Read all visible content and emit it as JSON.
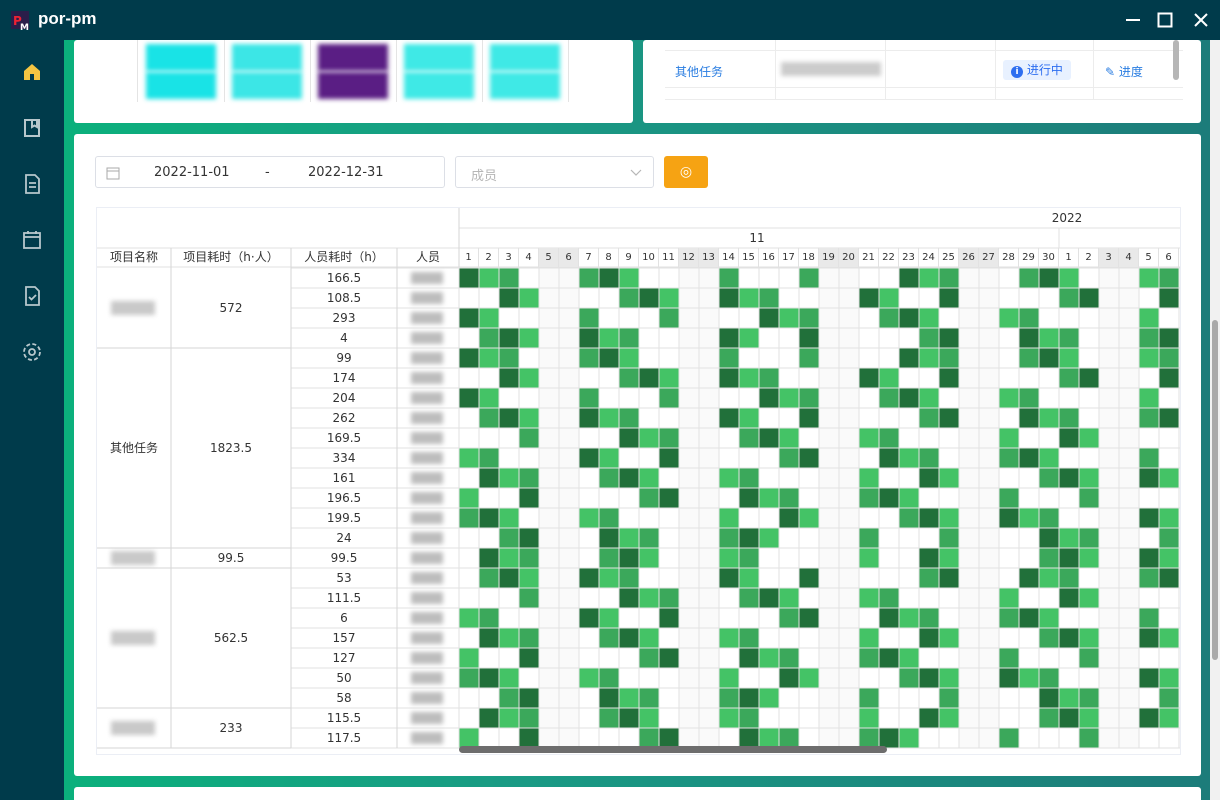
{
  "app": {
    "title": "por-pm"
  },
  "window_controls": {
    "minimize": "minimize",
    "maximize": "maximize",
    "close": "close"
  },
  "sidebar": {
    "items": [
      {
        "icon": "home-icon",
        "active": true
      },
      {
        "icon": "book-icon",
        "active": false
      },
      {
        "icon": "document-icon",
        "active": false
      },
      {
        "icon": "calendar-icon",
        "active": false
      },
      {
        "icon": "task-check-icon",
        "active": false
      },
      {
        "icon": "gear-icon",
        "active": false
      }
    ]
  },
  "top_right_table": {
    "rows": [
      {
        "name": "其他任务",
        "status": "进行中",
        "action": "进度"
      }
    ]
  },
  "filter": {
    "date_start": "2022-11-01",
    "date_separator": "-",
    "date_end": "2022-12-31",
    "member_placeholder": "成员",
    "search_label": "◎"
  },
  "gantt": {
    "year_label": "2022",
    "month_label": "11",
    "headers": {
      "project": "项目名称",
      "project_hours": "项目耗时（h·人）",
      "person_hours": "人员耗时（h）",
      "person": "人员"
    },
    "days": [
      "1",
      "2",
      "3",
      "4",
      "5",
      "6",
      "7",
      "8",
      "9",
      "10",
      "11",
      "12",
      "13",
      "14",
      "15",
      "16",
      "17",
      "18",
      "19",
      "20",
      "21",
      "22",
      "23",
      "24",
      "25",
      "26",
      "27",
      "28",
      "29",
      "30",
      "1",
      "2",
      "3",
      "4",
      "5",
      "6"
    ],
    "weekend_days": [
      4,
      5,
      11,
      12,
      18,
      19,
      25,
      26,
      32,
      33
    ],
    "groups": [
      {
        "project": "",
        "total": "572",
        "rows": [
          "166.5",
          "108.5",
          "293",
          "4"
        ]
      },
      {
        "project": "其他任务",
        "total": "1823.5",
        "rows": [
          "99",
          "174",
          "204",
          "262",
          "169.5",
          "334",
          "161",
          "196.5",
          "199.5",
          "24"
        ]
      },
      {
        "project": "",
        "total": "99.5",
        "rows": [
          "99.5"
        ]
      },
      {
        "project": "",
        "total": "562.5",
        "rows": [
          "53",
          "111.5",
          "6",
          "157",
          "127",
          "50",
          "58"
        ]
      },
      {
        "project": "",
        "total": "233",
        "rows": [
          "115.5",
          "117.5"
        ]
      }
    ],
    "colors": {
      "dark": "#21703a",
      "mid": "#3ba85b",
      "light": "#44c366"
    }
  }
}
